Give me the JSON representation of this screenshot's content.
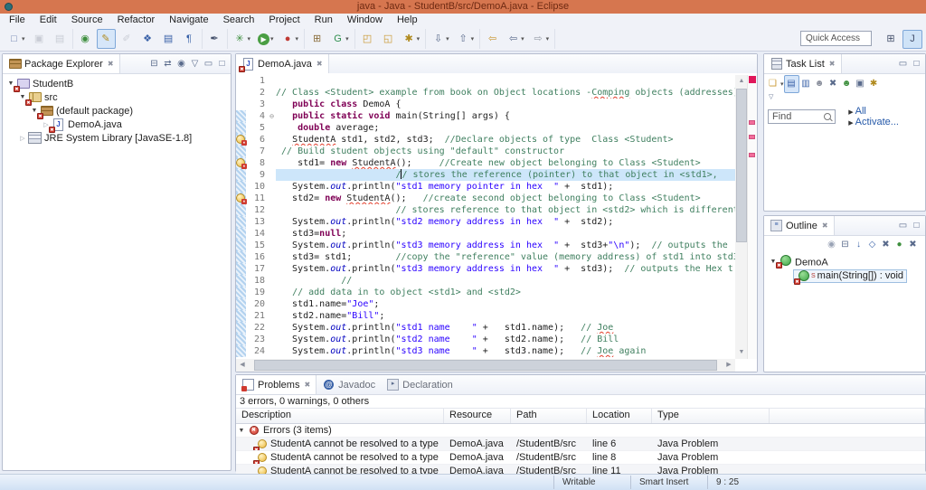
{
  "window": {
    "title": "java - Java - StudentB/src/DemoA.java - Eclipse"
  },
  "menu": {
    "items": [
      "File",
      "Edit",
      "Source",
      "Refactor",
      "Navigate",
      "Search",
      "Project",
      "Run",
      "Window",
      "Help"
    ]
  },
  "toolbar": {
    "quick_access": "Quick Access",
    "groups": [
      [
        {
          "name": "new-wizard-icon",
          "glyph": "□",
          "color": "#6b7fae",
          "dropdown": true
        },
        {
          "name": "save-icon",
          "glyph": "▣",
          "color": "#9aa0ab",
          "disabled": true
        },
        {
          "name": "save-all-icon",
          "glyph": "▤",
          "color": "#9aa0ab",
          "disabled": true
        }
      ],
      [
        {
          "name": "open-task-icon",
          "glyph": "◉",
          "color": "#3e8f3e"
        },
        {
          "name": "mark-occurrences-icon",
          "glyph": "✎",
          "color": "#b08a1e",
          "highlight": true
        },
        {
          "name": "external-tools-icon",
          "glyph": "✐",
          "color": "#9aa0ab",
          "disabled": true
        },
        {
          "name": "new-report-icon",
          "glyph": "❖",
          "color": "#3a62a8"
        },
        {
          "name": "source-view-icon",
          "glyph": "▤",
          "color": "#3a62a8"
        },
        {
          "name": "show-whitespace-icon",
          "glyph": "¶",
          "color": "#3a62a8"
        }
      ],
      [
        {
          "name": "selection-tool-icon",
          "glyph": "✒",
          "color": "#44506b"
        }
      ],
      [
        {
          "name": "debug-icon",
          "glyph": "✳",
          "color": "#3e8f3e",
          "dropdown": true
        },
        {
          "name": "run-icon",
          "glyph": "▶",
          "color": "#ffffff",
          "round": true,
          "dropdown": true
        },
        {
          "name": "profile-icon",
          "glyph": "●",
          "color": "#c03a34",
          "dropdown": true
        }
      ],
      [
        {
          "name": "new-java-project-icon",
          "glyph": "⊞",
          "color": "#8a6d3b"
        },
        {
          "name": "update-icon",
          "glyph": "G",
          "color": "#2f8f4e",
          "dropdown": true
        }
      ],
      [
        {
          "name": "import-icon",
          "glyph": "◰",
          "color": "#c9972f"
        },
        {
          "name": "export-icon",
          "glyph": "◱",
          "color": "#c9972f"
        },
        {
          "name": "search-icon",
          "glyph": "✱",
          "color": "#b08a1e",
          "dropdown": true
        }
      ],
      [
        {
          "name": "next-annotation-icon",
          "glyph": "⇩",
          "color": "#5a6b8c",
          "dropdown": true
        },
        {
          "name": "prev-annotation-icon",
          "glyph": "⇧",
          "color": "#5a6b8c",
          "dropdown": true
        }
      ],
      [
        {
          "name": "last-edit-icon",
          "glyph": "⇦",
          "color": "#c9972f"
        },
        {
          "name": "back-icon",
          "glyph": "⇦",
          "color": "#5a6b8c",
          "dropdown": true
        },
        {
          "name": "forward-icon",
          "glyph": "⇨",
          "color": "#9aa0ab",
          "dropdown": true
        }
      ]
    ],
    "perspectives": [
      {
        "name": "open-perspective-icon",
        "glyph": "⊞",
        "highlight": false
      },
      {
        "name": "java-perspective-icon",
        "glyph": "J",
        "highlight": true
      }
    ]
  },
  "package_explorer": {
    "title": "Package Explorer",
    "toolbar_icons": [
      {
        "name": "collapse-all-icon",
        "glyph": "⊟"
      },
      {
        "name": "link-editor-icon",
        "glyph": "⇄"
      },
      {
        "name": "focus-icon",
        "glyph": "◉"
      },
      {
        "name": "view-menu-icon",
        "glyph": "▽"
      },
      {
        "name": "minimize-icon",
        "glyph": "▭"
      },
      {
        "name": "maximize-icon",
        "glyph": "□"
      }
    ],
    "tree": [
      {
        "label": "StudentB",
        "depth": 0,
        "icon": "proj",
        "open": true,
        "expandable": true,
        "error": true
      },
      {
        "label": "src",
        "depth": 1,
        "icon": "src",
        "open": true,
        "expandable": true,
        "error": true
      },
      {
        "label": "(default package)",
        "depth": 2,
        "icon": "pkg",
        "open": true,
        "expandable": true,
        "error": true
      },
      {
        "label": "DemoA.java",
        "depth": 3,
        "icon": "jfile",
        "open": false,
        "expandable": true,
        "error": true
      },
      {
        "label": "JRE System Library [JavaSE-1.8]",
        "depth": 1,
        "icon": "lib",
        "open": false,
        "expandable": true,
        "error": false
      }
    ]
  },
  "editor": {
    "tab_label": "DemoA.java",
    "lines": [
      {
        "n": 1,
        "seg": []
      },
      {
        "n": 2,
        "seg": [
          [
            "c",
            "// Class <Student> example from book on Object locations -"
          ],
          [
            "w",
            "Comping"
          ],
          [
            "c",
            " objects (addresses)"
          ]
        ]
      },
      {
        "n": 3,
        "seg": [
          [
            "p",
            "   "
          ],
          [
            "k",
            "public"
          ],
          [
            "p",
            " "
          ],
          [
            "k",
            "class"
          ],
          [
            "p",
            " DemoA {"
          ]
        ]
      },
      {
        "n": 4,
        "hatch": true,
        "mark": "fold",
        "seg": [
          [
            "p",
            "   "
          ],
          [
            "k",
            "public"
          ],
          [
            "p",
            " "
          ],
          [
            "k",
            "static"
          ],
          [
            "p",
            " "
          ],
          [
            "k",
            "void"
          ],
          [
            "p",
            " main(String[] args) {"
          ]
        ]
      },
      {
        "n": 5,
        "hatch": true,
        "seg": [
          [
            "p",
            "    "
          ],
          [
            "k",
            "double"
          ],
          [
            "p",
            " average;"
          ]
        ]
      },
      {
        "n": 6,
        "hatch": true,
        "mark": "error",
        "seg": [
          [
            "p",
            "   "
          ],
          [
            "e",
            "StudentA"
          ],
          [
            "p",
            " std1, std2, std3;  "
          ],
          [
            "c",
            "//Declare objects of type  Class <Student>"
          ]
        ]
      },
      {
        "n": 7,
        "hatch": true,
        "seg": [
          [
            "p",
            " "
          ],
          [
            "c",
            "// Build student objects using \"default\" constructor"
          ]
        ]
      },
      {
        "n": 8,
        "hatch": true,
        "mark": "error",
        "seg": [
          [
            "p",
            "    std1= "
          ],
          [
            "k",
            "new"
          ],
          [
            "p",
            " "
          ],
          [
            "e",
            "StudentA"
          ],
          [
            "p",
            "();     "
          ],
          [
            "c",
            "//Create new object belonging to Class <Student>"
          ]
        ]
      },
      {
        "n": 9,
        "hatch": true,
        "hl": true,
        "seg": [
          [
            "p",
            "                      "
          ],
          [
            "c",
            "/"
          ],
          [
            "cur",
            ""
          ],
          [
            "c",
            "/ stores the reference (pointer) to that object in <std1>,"
          ]
        ]
      },
      {
        "n": 10,
        "hatch": true,
        "seg": [
          [
            "p",
            "   System."
          ],
          [
            "f",
            "out"
          ],
          [
            "p",
            ".println("
          ],
          [
            "s",
            "\"std1 memory pointer in hex  \""
          ],
          [
            "p",
            " +  std1);"
          ]
        ]
      },
      {
        "n": 11,
        "hatch": true,
        "mark": "error",
        "seg": [
          [
            "p",
            "   std2= "
          ],
          [
            "k",
            "new"
          ],
          [
            "p",
            " "
          ],
          [
            "e",
            "StudentA"
          ],
          [
            "p",
            "();   "
          ],
          [
            "c",
            "//create second object belonging to Class <Student>"
          ]
        ]
      },
      {
        "n": 12,
        "hatch": true,
        "seg": [
          [
            "p",
            "                      "
          ],
          [
            "c",
            "// stores reference to that object in <std2> which is different"
          ]
        ]
      },
      {
        "n": 13,
        "hatch": true,
        "seg": [
          [
            "p",
            "   System."
          ],
          [
            "f",
            "out"
          ],
          [
            "p",
            ".println("
          ],
          [
            "s",
            "\"std2 memory address in hex  \""
          ],
          [
            "p",
            " +  std2);"
          ]
        ]
      },
      {
        "n": 14,
        "hatch": true,
        "seg": [
          [
            "p",
            "   std3="
          ],
          [
            "k",
            "null"
          ],
          [
            "p",
            ";"
          ]
        ]
      },
      {
        "n": 15,
        "hatch": true,
        "seg": [
          [
            "p",
            "   System."
          ],
          [
            "f",
            "out"
          ],
          [
            "p",
            ".println("
          ],
          [
            "s",
            "\"std3 memory address in hex  \""
          ],
          [
            "p",
            " +  std3+"
          ],
          [
            "s",
            "\"\\n\""
          ],
          [
            "p",
            ");  "
          ],
          [
            "c",
            "// outputs the "
          ]
        ]
      },
      {
        "n": 16,
        "hatch": true,
        "seg": [
          [
            "p",
            "   std3= std1;        "
          ],
          [
            "c",
            "//copy the \"reference\" value (memory address) of std1 into std3"
          ]
        ]
      },
      {
        "n": 17,
        "hatch": true,
        "seg": [
          [
            "p",
            "   System."
          ],
          [
            "f",
            "out"
          ],
          [
            "p",
            ".println("
          ],
          [
            "s",
            "\"std3 memory address in hex  \""
          ],
          [
            "p",
            " +  std3);  "
          ],
          [
            "c",
            "// outputs the Hex t"
          ]
        ]
      },
      {
        "n": 18,
        "hatch": true,
        "seg": [
          [
            "p",
            "            "
          ],
          [
            "c",
            "//"
          ]
        ]
      },
      {
        "n": 19,
        "hatch": true,
        "seg": [
          [
            "p",
            "   "
          ],
          [
            "c",
            "// add data in to object <std1> and <std2>"
          ]
        ]
      },
      {
        "n": 20,
        "hatch": true,
        "seg": [
          [
            "p",
            "   std1.name="
          ],
          [
            "s",
            "\"Joe\""
          ],
          [
            "p",
            ";"
          ]
        ]
      },
      {
        "n": 21,
        "hatch": true,
        "seg": [
          [
            "p",
            "   std2.name="
          ],
          [
            "s",
            "\"Bill\""
          ],
          [
            "p",
            ";"
          ]
        ]
      },
      {
        "n": 22,
        "hatch": true,
        "seg": [
          [
            "p",
            "   System."
          ],
          [
            "f",
            "out"
          ],
          [
            "p",
            ".println("
          ],
          [
            "s",
            "\"std1 name    \""
          ],
          [
            "p",
            " +   std1.name);   "
          ],
          [
            "c",
            "// "
          ],
          [
            "w",
            "Joe"
          ]
        ]
      },
      {
        "n": 23,
        "hatch": true,
        "seg": [
          [
            "p",
            "   System."
          ],
          [
            "f",
            "out"
          ],
          [
            "p",
            ".println("
          ],
          [
            "s",
            "\"std2 name    \""
          ],
          [
            "p",
            " +   std2.name);   "
          ],
          [
            "c",
            "// Bill"
          ]
        ]
      },
      {
        "n": 24,
        "hatch": true,
        "seg": [
          [
            "p",
            "   System."
          ],
          [
            "f",
            "out"
          ],
          [
            "p",
            ".println("
          ],
          [
            "s",
            "\"std3 name    \""
          ],
          [
            "p",
            " +   std3.name);   "
          ],
          [
            "c",
            "// "
          ],
          [
            "w",
            "Joe"
          ],
          [
            "c",
            " again"
          ]
        ]
      }
    ]
  },
  "task_list": {
    "title": "Task List",
    "toolbar_icons": [
      {
        "name": "new-task-icon",
        "glyph": "❏",
        "color": "#c9972f",
        "dropdown": true
      },
      {
        "name": "categorized-icon",
        "glyph": "▤",
        "color": "#3a62a8",
        "highlight": true
      },
      {
        "name": "scheduled-icon",
        "glyph": "▥",
        "color": "#3a62a8"
      },
      {
        "name": "presentation-icon",
        "glyph": "☻",
        "color": "#8a8f9c"
      },
      {
        "name": "hide-completed-icon",
        "glyph": "✖",
        "color": "#5a6b8c"
      },
      {
        "name": "group-icon",
        "glyph": "☻",
        "color": "#3e8f3e"
      },
      {
        "name": "duplicates-icon",
        "glyph": "▣",
        "color": "#5a6b8c"
      },
      {
        "name": "repositories-icon",
        "glyph": "✱",
        "color": "#b08a1e"
      }
    ],
    "find_label": "Find",
    "links": [
      "All",
      "Activate..."
    ]
  },
  "outline": {
    "title": "Outline",
    "toolbar_icons": [
      {
        "name": "focus-icon",
        "glyph": "◉",
        "color": "#9aa3b5"
      },
      {
        "name": "collapse-all-icon",
        "glyph": "⊟",
        "color": "#5a6b8c"
      },
      {
        "name": "sort-icon",
        "glyph": "↓",
        "color": "#3a62a8"
      },
      {
        "name": "hide-fields-icon",
        "glyph": "◇",
        "color": "#3a62a8"
      },
      {
        "name": "hide-static-icon",
        "glyph": "✖",
        "color": "#5a6b8c"
      },
      {
        "name": "hide-nonpublic-icon",
        "glyph": "●",
        "color": "#3e8f3e"
      },
      {
        "name": "hide-local-icon",
        "glyph": "✖",
        "color": "#5a6b8c"
      }
    ],
    "items": [
      {
        "label": "DemoA",
        "icon": "class",
        "error": true,
        "depth": 0,
        "open": true,
        "selected": false,
        "static": false
      },
      {
        "label": "main(String[]) : void",
        "icon": "class",
        "error": true,
        "depth": 1,
        "selected": true,
        "static": true
      }
    ]
  },
  "problems": {
    "tabs": [
      {
        "label": "Problems",
        "icon": "problems",
        "active": true
      },
      {
        "label": "Javadoc",
        "icon": "javadoc",
        "active": false
      },
      {
        "label": "Declaration",
        "icon": "declaration",
        "active": false
      }
    ],
    "summary": "3 errors, 0 warnings, 0 others",
    "columns": [
      "Description",
      "Resource",
      "Path",
      "Location",
      "Type"
    ],
    "group_label": "Errors (3 items)",
    "rows": [
      {
        "description": "StudentA cannot be resolved to a type",
        "resource": "DemoA.java",
        "path": "/StudentB/src",
        "location": "line 6",
        "type": "Java Problem"
      },
      {
        "description": "StudentA cannot be resolved to a type",
        "resource": "DemoA.java",
        "path": "/StudentB/src",
        "location": "line 8",
        "type": "Java Problem"
      },
      {
        "description": "StudentA cannot be resolved to a type",
        "resource": "DemoA.java",
        "path": "/StudentB/src",
        "location": "line 11",
        "type": "Java Problem"
      }
    ]
  },
  "status_bar": {
    "writable": "Writable",
    "insert_mode": "Smart Insert",
    "cursor_position": "9 : 25"
  }
}
